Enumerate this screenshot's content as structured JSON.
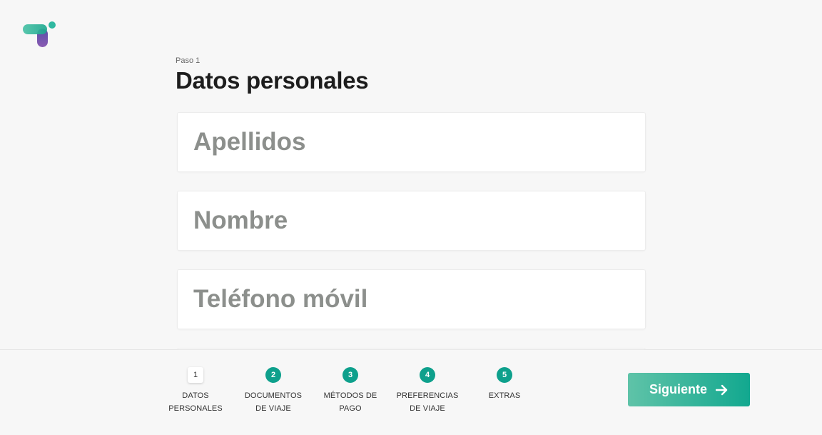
{
  "header": {
    "step_label": "Paso 1",
    "title": "Datos personales"
  },
  "form": {
    "fields": [
      {
        "placeholder": "Apellidos",
        "value": ""
      },
      {
        "placeholder": "Nombre",
        "value": ""
      },
      {
        "placeholder": "Teléfono móvil",
        "value": ""
      },
      {
        "placeholder": "",
        "value": ""
      }
    ]
  },
  "stepper": {
    "steps": [
      {
        "number": "1",
        "line1": "DATOS",
        "line2": "PERSONALES",
        "active": true
      },
      {
        "number": "2",
        "line1": "DOCUMENTOS",
        "line2": "DE VIAJE",
        "active": false
      },
      {
        "number": "3",
        "line1": "MÉTODOS DE",
        "line2": "PAGO",
        "active": false
      },
      {
        "number": "4",
        "line1": "PREFERENCIAS",
        "line2": "DE VIAJE",
        "active": false
      },
      {
        "number": "5",
        "line1": "EXTRAS",
        "line2": "",
        "active": false
      }
    ]
  },
  "actions": {
    "next_label": "Siguiente",
    "next_icon": "arrow-right-icon"
  },
  "colors": {
    "accent": "#0ea08c",
    "button_gradient_start": "#5fc3a8",
    "button_gradient_end": "#12a88f",
    "logo_teal": "#2fb8a0",
    "logo_purple": "#7a4fa8"
  }
}
